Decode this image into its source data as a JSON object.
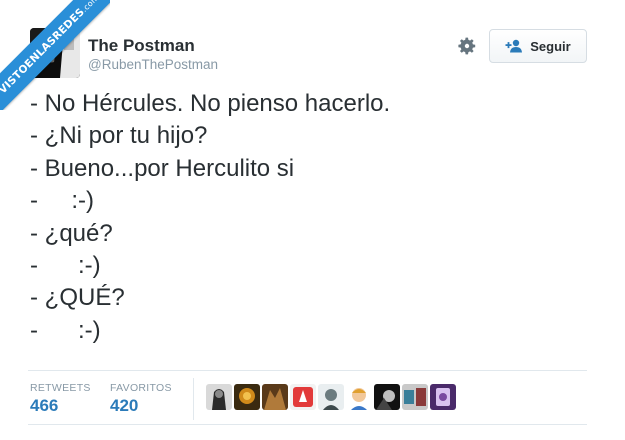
{
  "ribbon": {
    "main": "VISTOENLASREDES",
    "suffix": ".com"
  },
  "user": {
    "name": "The Postman",
    "handle": "@RubenThePostman"
  },
  "follow": {
    "label": "Seguir"
  },
  "tweet": {
    "lines": [
      "- No Hércules. No pienso hacerlo.",
      "- ¿Ni por tu hijo?",
      "- Bueno...por Herculito si",
      "-     :-)",
      "- ¿qué?",
      "-      :-)",
      "- ¿QUÉ?",
      "-      :-)"
    ]
  },
  "stats": {
    "retweets_label": "RETWEETS",
    "retweets_value": "466",
    "favorites_label": "FAVORITOS",
    "favorites_value": "420"
  },
  "colors": {
    "accent": "#2b7bb9",
    "ribbon": "#2a8fd8",
    "muted": "#8899a6"
  },
  "icons": [
    "gear-icon",
    "follow-user-icon"
  ]
}
